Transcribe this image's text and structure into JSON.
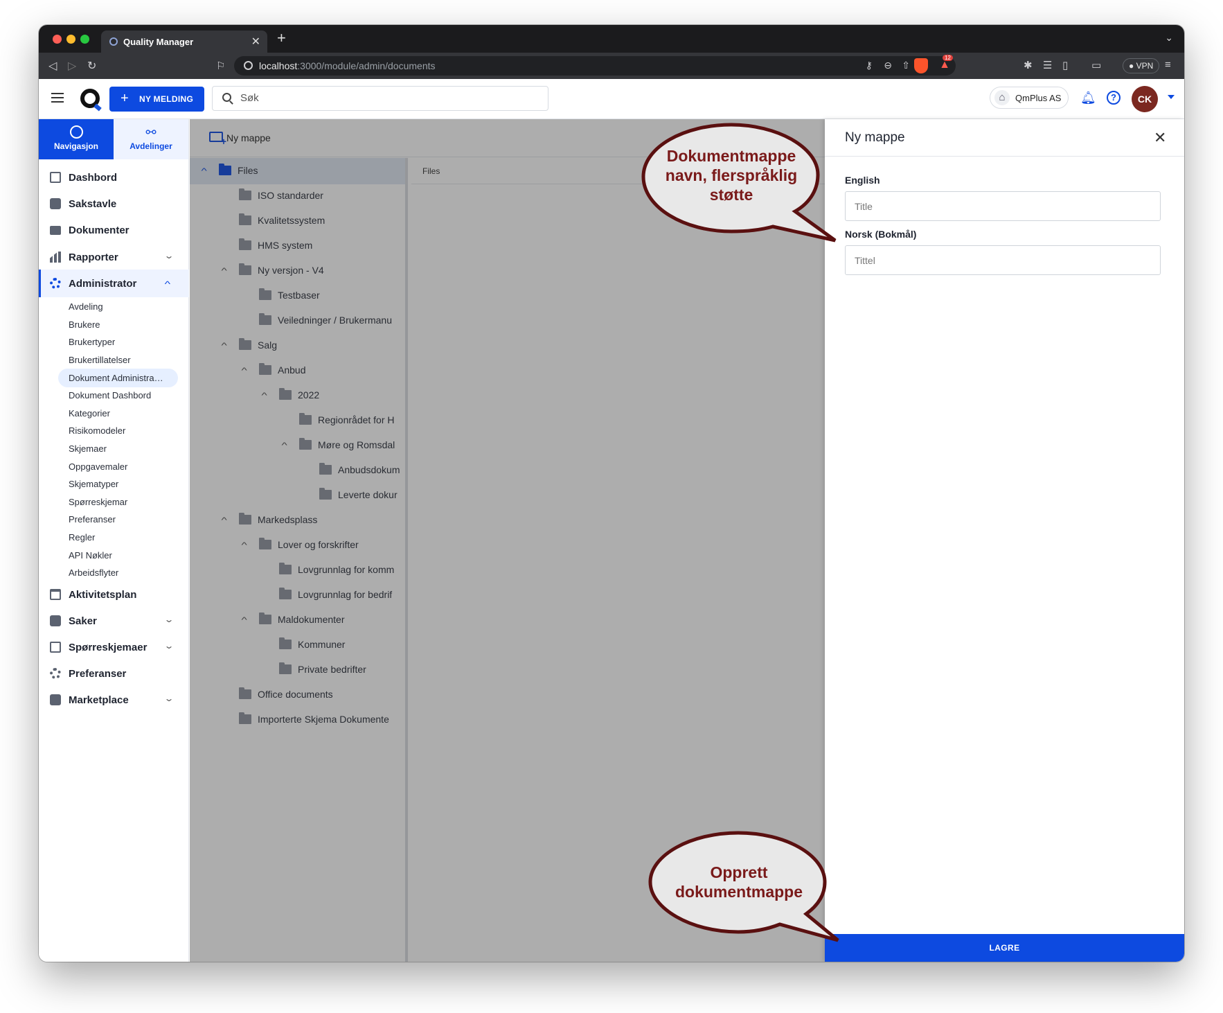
{
  "browser": {
    "tab_title": "Quality Manager",
    "url_host": "localhost",
    "url_path": ":3000/module/admin/documents",
    "alert_badge": "12",
    "vpn_label": "VPN"
  },
  "header": {
    "new_message_label": "NY MELDING",
    "search_placeholder": "Søk",
    "company_name": "QmPlus AS",
    "avatar_initials": "CK"
  },
  "sidebar": {
    "tabs": [
      {
        "label": "Navigasjon",
        "icon": "compass-icon"
      },
      {
        "label": "Avdelinger",
        "icon": "org-chart-icon"
      }
    ],
    "items": [
      {
        "label": "Dashbord",
        "icon": "dashboard-icon"
      },
      {
        "label": "Sakstavle",
        "icon": "board-icon"
      },
      {
        "label": "Dokumenter",
        "icon": "folder-icon"
      },
      {
        "label": "Rapporter",
        "icon": "bar-chart-icon",
        "expandable": true
      },
      {
        "label": "Administrator",
        "icon": "gear-icon",
        "expandable": true,
        "expanded": true
      }
    ],
    "admin_sub": [
      "Avdeling",
      "Brukere",
      "Brukertyper",
      "Brukertillatelser",
      "Dokument Administrasjon",
      "Dokument Dashbord",
      "Kategorier",
      "Risikomodeler",
      "Skjemaer",
      "Oppgavemaler",
      "Skjematyper",
      "Spørreskjemar",
      "Preferanser",
      "Regler",
      "API Nøkler",
      "Arbeidsflyter"
    ],
    "items_after": [
      {
        "label": "Aktivitetsplan",
        "icon": "calendar-icon"
      },
      {
        "label": "Saker",
        "icon": "cases-icon",
        "expandable": true
      },
      {
        "label": "Spørreskjemaer",
        "icon": "clipboard-icon",
        "expandable": true
      },
      {
        "label": "Preferanser",
        "icon": "settings-icon"
      },
      {
        "label": "Marketplace",
        "icon": "store-icon",
        "expandable": true
      }
    ]
  },
  "toolbar": {
    "new_folder_label": "Ny mappe"
  },
  "tree": {
    "nodes": [
      {
        "label": "Files",
        "depth": 0,
        "expanded": true
      },
      {
        "label": "ISO standarder",
        "depth": 1
      },
      {
        "label": "Kvalitetssystem",
        "depth": 1
      },
      {
        "label": "HMS system",
        "depth": 1
      },
      {
        "label": "Ny versjon - V4",
        "depth": 1,
        "expanded": true
      },
      {
        "label": "Testbaser",
        "depth": 2
      },
      {
        "label": "Veiledninger / Brukermanu",
        "depth": 2
      },
      {
        "label": "Salg",
        "depth": 1,
        "expanded": true
      },
      {
        "label": "Anbud",
        "depth": 2,
        "expanded": true
      },
      {
        "label": "2022",
        "depth": 3,
        "expanded": true
      },
      {
        "label": "Regionrådet for H",
        "depth": 4
      },
      {
        "label": "Møre og Romsdal",
        "depth": 4,
        "expanded": true
      },
      {
        "label": "Anbudsdokum",
        "depth": 5
      },
      {
        "label": "Leverte dokur",
        "depth": 5
      },
      {
        "label": "Markedsplass",
        "depth": 1,
        "expanded": true
      },
      {
        "label": "Lover og forskrifter",
        "depth": 2,
        "expanded": true
      },
      {
        "label": "Lovgrunnlag for komm",
        "depth": 3
      },
      {
        "label": "Lovgrunnlag for bedrif",
        "depth": 3
      },
      {
        "label": "Maldokumenter",
        "depth": 2,
        "expanded": true
      },
      {
        "label": "Kommuner",
        "depth": 3
      },
      {
        "label": "Private bedrifter",
        "depth": 3
      },
      {
        "label": "Office documents",
        "depth": 1
      },
      {
        "label": "Importerte Skjema Dokumente",
        "depth": 1
      }
    ]
  },
  "breadcrumb": "Files",
  "drawer": {
    "title": "Ny mappe",
    "fields": [
      {
        "label": "English",
        "placeholder": "Title"
      },
      {
        "label": "Norsk (Bokmål)",
        "placeholder": "Tittel"
      }
    ],
    "save_label": "LAGRE"
  },
  "callouts": {
    "top": [
      "Dokumentmappe",
      "navn, flerspråklig",
      "støtte"
    ],
    "bottom": [
      "Opprett",
      "dokumentmappe"
    ],
    "fill": "#e8e8e8",
    "stroke": "#5a1010",
    "text_color": "#7a1a1a"
  },
  "colors": {
    "accent": "#0d4ae0",
    "avatar": "#7b2820"
  }
}
